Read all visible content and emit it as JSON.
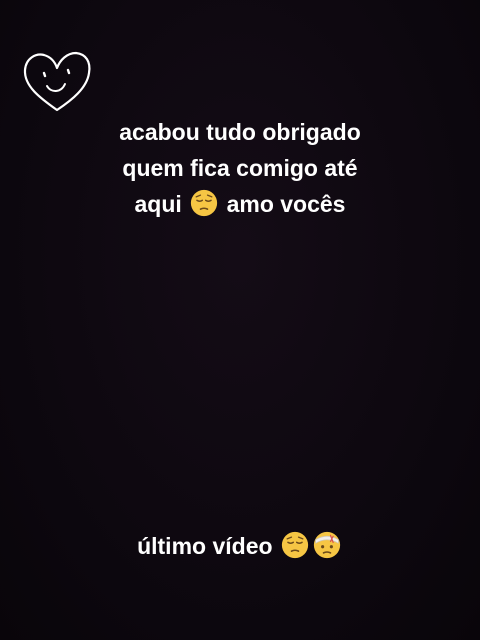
{
  "caption": {
    "line1": "acabou tudo obrigado",
    "line2": "quem fica comigo até",
    "line3_before": "aqui",
    "line3_after": "amo vocês"
  },
  "footer": {
    "text": "último vídeo"
  },
  "icons": {
    "doodle": "smiling-heart-doodle-icon",
    "line3_emoji": "pensive-face-emoji",
    "footer_emoji_1": "pensive-face-emoji",
    "footer_emoji_2": "face-with-head-bandage-emoji"
  },
  "colors": {
    "background": "#0e0810",
    "text": "#ffffff",
    "emoji_yellow": "#f6c644"
  }
}
